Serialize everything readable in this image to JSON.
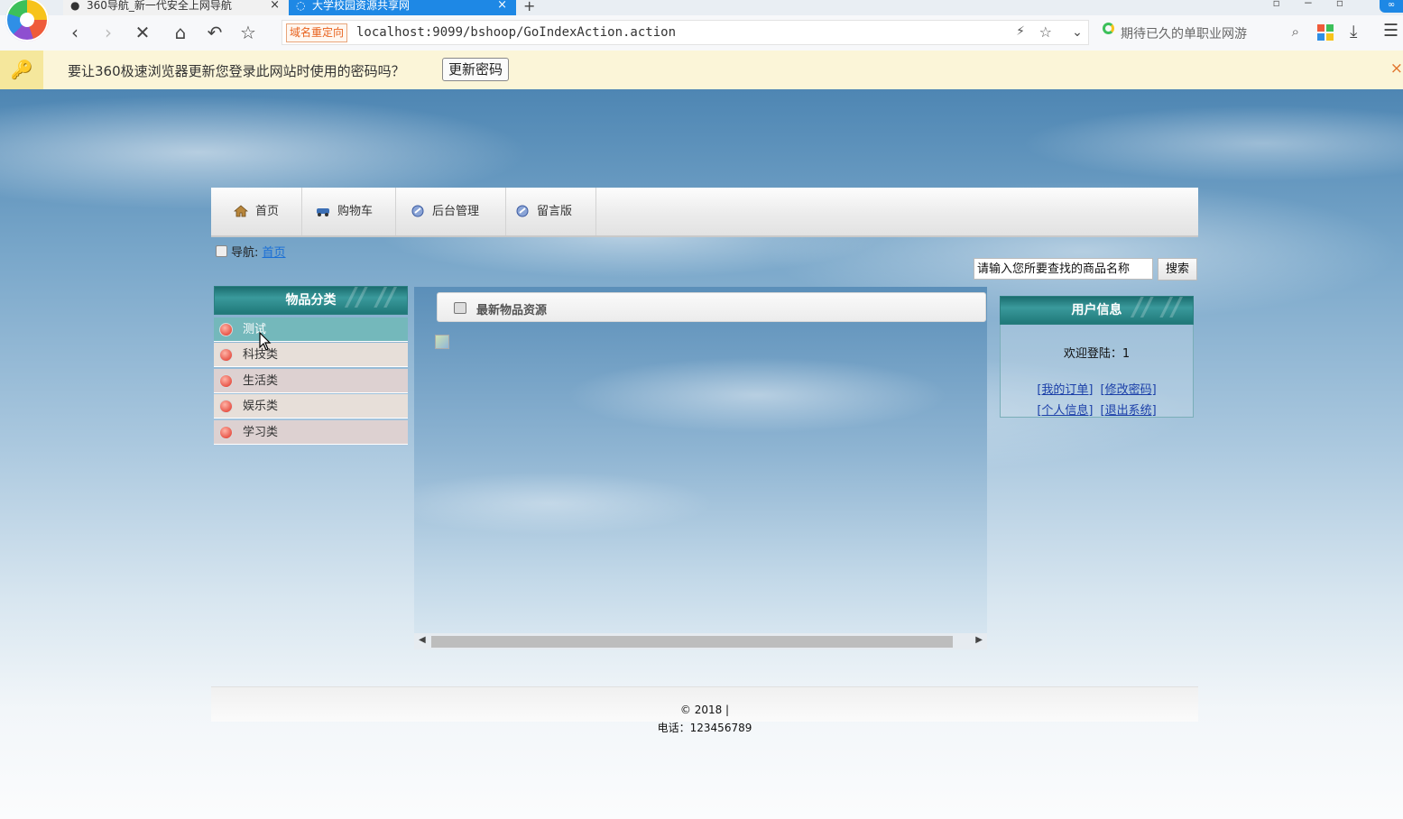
{
  "browser": {
    "tabs": [
      {
        "label": "360导航_新一代安全上网导航",
        "active": false
      },
      {
        "label": "大学校园资源共享网",
        "active": true
      }
    ],
    "url": "localhost:9099/bshoop/GoIndexAction.action",
    "redirect_badge": "域名重定向",
    "search_placeholder": "期待已久的单职业网游",
    "password_prompt": "要让360极速浏览器更新您登录此网站时使用的密码吗？",
    "password_button": "更新密码",
    "close_symbol": "×",
    "accent_color": "#1e88e5"
  },
  "nav": {
    "items": [
      {
        "label": "首页",
        "icon": "home-icon"
      },
      {
        "label": "购物车",
        "icon": "cart-icon"
      },
      {
        "label": "后台管理",
        "icon": "admin-icon"
      },
      {
        "label": "留言版",
        "icon": "message-icon"
      }
    ]
  },
  "breadcrumb": {
    "label": "导航:",
    "link": "首页"
  },
  "search": {
    "placeholder": "请输入您所要查找的商品名称",
    "button": "搜索"
  },
  "categories": {
    "title": "物品分类",
    "items": [
      "测试",
      "科技类",
      "生活类",
      "娱乐类",
      "学习类"
    ],
    "active_index": 0
  },
  "main": {
    "title": "最新物品资源"
  },
  "user": {
    "title": "用户信息",
    "welcome": "欢迎登陆：1",
    "links": [
      "[我的订单]",
      "[修改密码]",
      "[个人信息]",
      "[退出系统]"
    ]
  },
  "footer": {
    "copyright": "© 2018 |",
    "phone": "电话：123456789"
  }
}
